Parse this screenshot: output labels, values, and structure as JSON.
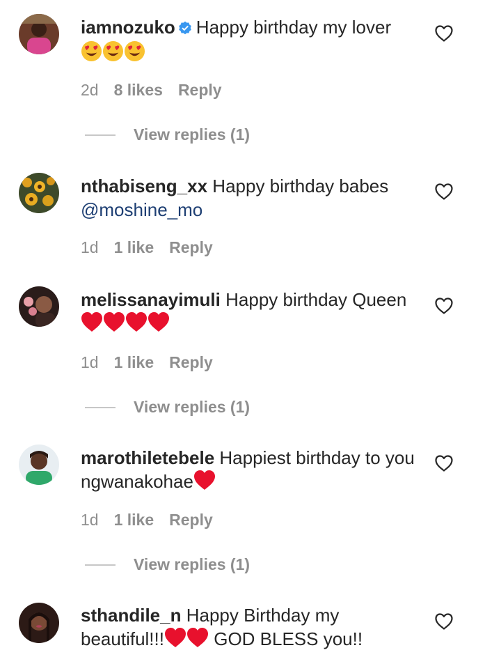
{
  "comments": [
    {
      "username": "iamnozuko",
      "verified": true,
      "text": "Happy birthday my lover",
      "time": "2d",
      "likes": "8 likes",
      "reply": "Reply",
      "view_replies": "View replies (1)"
    },
    {
      "username": "nthabiseng_xx",
      "verified": false,
      "text": "Happy birthday babes",
      "mention": "@moshine_mo",
      "time": "1d",
      "likes": "1 like",
      "reply": "Reply"
    },
    {
      "username": "melissanayimuli",
      "verified": false,
      "text": "Happy birthday Queen",
      "time": "1d",
      "likes": "1 like",
      "reply": "Reply",
      "view_replies": "View replies (1)"
    },
    {
      "username": "marothiletebele",
      "verified": false,
      "text": "Happiest birthday to you ngwanakohae",
      "time": "1d",
      "likes": "1 like",
      "reply": "Reply",
      "view_replies": "View replies (1)"
    },
    {
      "username": "sthandile_n",
      "verified": false,
      "text": "Happy Birthday my beautiful!!!",
      "text_after": "GOD BLESS you!!"
    }
  ],
  "icons": {
    "like": "heart-outline-icon",
    "verified": "verified-badge-icon"
  },
  "colors": {
    "verified": "#3897f0",
    "heart_emoji": "#e8112d",
    "mention": "#1e3f73",
    "meta": "#8e8e8e"
  }
}
